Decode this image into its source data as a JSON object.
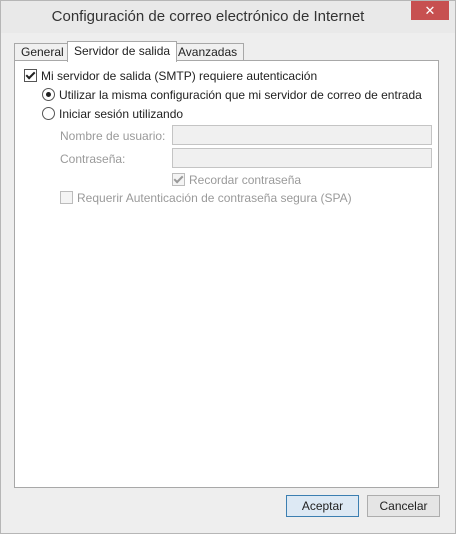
{
  "window": {
    "title": "Configuración de correo electrónico de Internet",
    "close_glyph": "✕"
  },
  "tabs": [
    {
      "label": "General",
      "active": false
    },
    {
      "label": "Servidor de salida",
      "active": true
    },
    {
      "label": "Avanzadas",
      "active": false
    }
  ],
  "smtp_auth": {
    "label": "Mi servidor de salida (SMTP) requiere autenticación",
    "checked": true
  },
  "options": {
    "same_settings_label": "Utilizar la misma configuración que mi servidor de correo de entrada",
    "same_settings_selected": true,
    "login_using_label": "Iniciar sesión utilizando",
    "login_using_selected": false
  },
  "fields": {
    "username_label": "Nombre de usuario:",
    "username_value": "",
    "password_label": "Contraseña:",
    "password_value": ""
  },
  "remember_password": {
    "label": "Recordar contraseña",
    "checked": true,
    "enabled": false
  },
  "spa": {
    "label": "Requerir Autenticación de contraseña segura (SPA)",
    "checked": false,
    "enabled": false
  },
  "buttons": {
    "ok_label": "Aceptar",
    "cancel_label": "Cancelar"
  }
}
